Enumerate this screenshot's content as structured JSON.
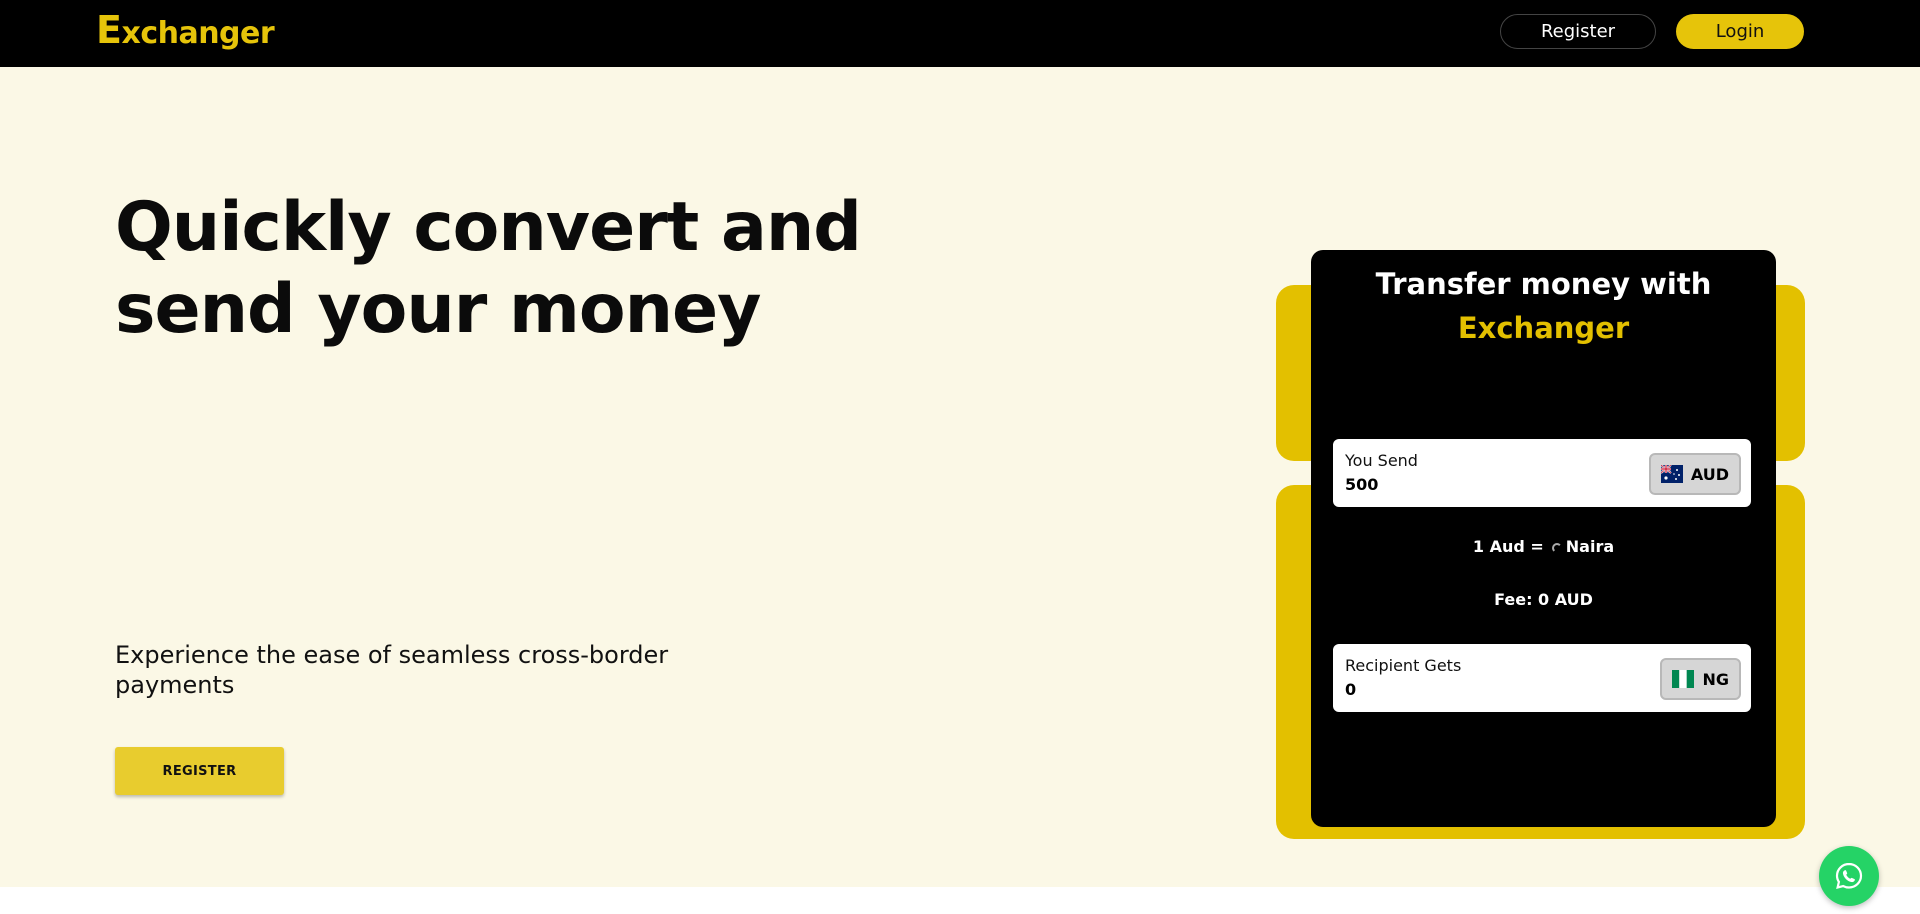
{
  "header": {
    "logo_first": "E",
    "logo_rest": "xchanger",
    "register_label": "Register",
    "login_label": "Login"
  },
  "hero": {
    "headline": "Quickly convert and send your money",
    "subline": "Experience the ease of seamless cross-border payments",
    "register_label": "REGISTER"
  },
  "card": {
    "title_line1": "Transfer money with",
    "title_brand": "Exchanger",
    "send": {
      "label": "You Send",
      "value": "500",
      "currency": "AUD",
      "flag_icon": "australia-flag-icon"
    },
    "rate_left": "1 Aud =",
    "rate_right": "Naira",
    "fee": "Fee: 0 AUD",
    "receive": {
      "label": "Recipient Gets",
      "value": "0",
      "currency": "NG",
      "flag_icon": "nigeria-flag-icon"
    }
  },
  "colors": {
    "brand_yellow": "#e3c000",
    "hero_bg": "#fbf8e6",
    "header_bg": "#000000",
    "whatsapp_green": "#25d366"
  },
  "floating": {
    "whatsapp_icon": "whatsapp-icon"
  }
}
